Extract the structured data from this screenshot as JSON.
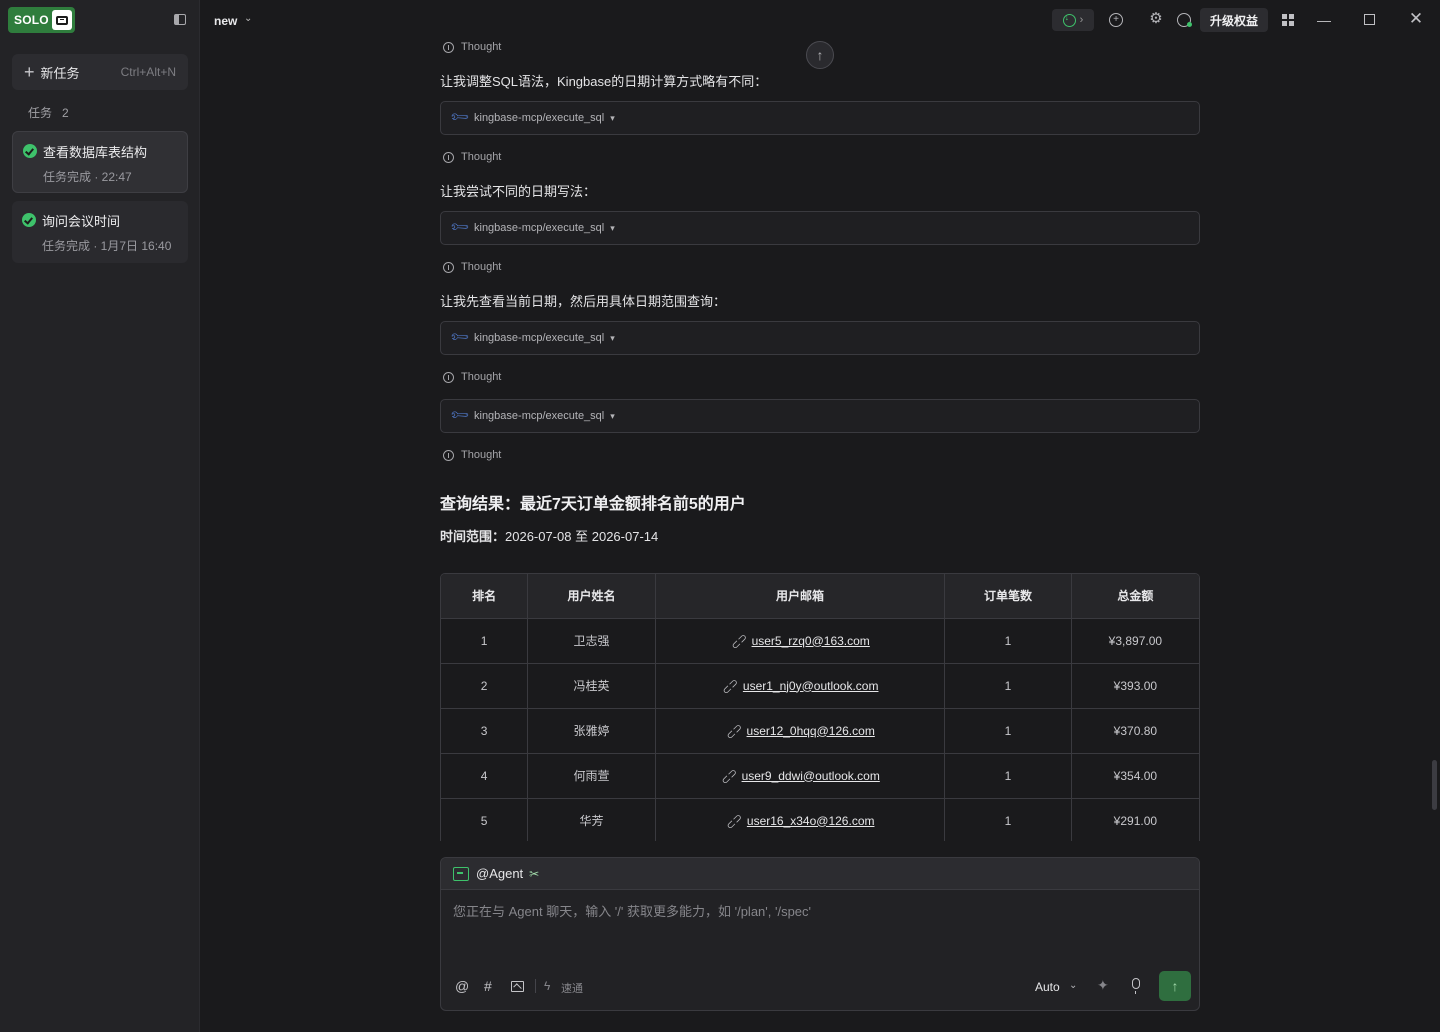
{
  "sidebar": {
    "logo_text": "SOLO",
    "new_task": {
      "label": "新任务",
      "shortcut": "Ctrl+Alt+N"
    },
    "tasks_heading": "任务",
    "tasks_count": "2",
    "tasks": [
      {
        "title": "查看数据库表结构",
        "status": "任务完成 · 22:47"
      },
      {
        "title": "询问会议时间",
        "status": "任务完成 · 1月7日 16:40"
      }
    ]
  },
  "topbar": {
    "project": "new",
    "upgrade_label": "升级权益"
  },
  "conversation": {
    "thought_label": "Thought",
    "tool_name": "kingbase-mcp/execute_sql",
    "messages": [
      "让我调整SQL语法，Kingbase的日期计算方式略有不同：",
      "让我尝试不同的日期写法：",
      "让我先查看当前日期，然后用具体日期范围查询："
    ],
    "result_title": "查询结果：最近7天订单金额排名前5的用户",
    "range_label": "时间范围：",
    "range_value": "2026-07-08 至 2026-07-14"
  },
  "table": {
    "headers": [
      "排名",
      "用户姓名",
      "用户邮箱",
      "订单笔数",
      "总金额"
    ],
    "rows": [
      {
        "rank": "1",
        "name": "卫志强",
        "email": "user5_rzq0@163.com",
        "orders": "1",
        "total": "¥3,897.00"
      },
      {
        "rank": "2",
        "name": "冯桂英",
        "email": "user1_nj0y@outlook.com",
        "orders": "1",
        "total": "¥393.00"
      },
      {
        "rank": "3",
        "name": "张雅婷",
        "email": "user12_0hqq@126.com",
        "orders": "1",
        "total": "¥370.80"
      },
      {
        "rank": "4",
        "name": "何雨萱",
        "email": "user9_ddwi@outlook.com",
        "orders": "1",
        "total": "¥354.00"
      },
      {
        "rank": "5",
        "name": "华芳",
        "email": "user16_x34o@126.com",
        "orders": "1",
        "total": "¥291.00"
      }
    ]
  },
  "composer": {
    "agent_label": "@Agent",
    "placeholder": "您正在与 Agent 聊天，输入 '/' 获取更多能力，如 '/plan', '/spec'",
    "speed_label": "速通",
    "mode_label": "Auto"
  },
  "colors": {
    "accent": "#3ec26b",
    "brand": "#2f7d3d",
    "tool_icon": "#5c8ff2"
  }
}
